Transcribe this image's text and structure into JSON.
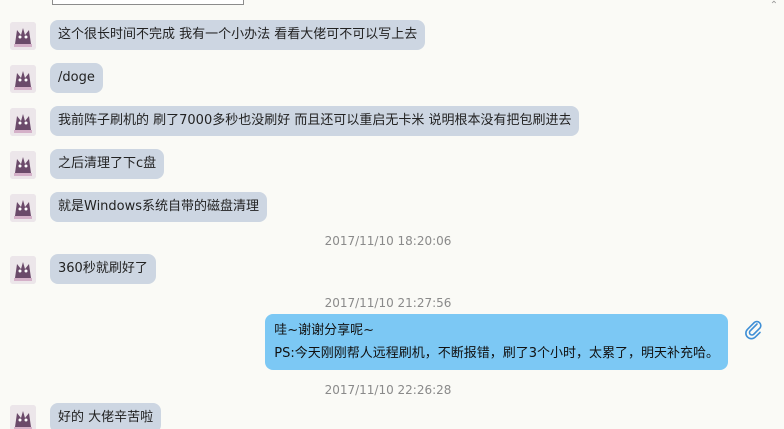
{
  "messages": [
    {
      "type": "in",
      "text": "这个很长时间不完成 我有一个小办法 看看大佬可不可以写上去"
    },
    {
      "type": "in",
      "text": "/doge"
    },
    {
      "type": "in",
      "text": "我前阵子刷机的 刷了7000多秒也没刷好 而且还可以重启无卡米 说明根本没有把包刷进去"
    },
    {
      "type": "in",
      "text": "之后清理了下c盘"
    },
    {
      "type": "in",
      "text": "就是Windows系统自带的磁盘清理"
    },
    {
      "type": "time",
      "text": "2017/11/10 18:20:06"
    },
    {
      "type": "in",
      "text": "360秒就刷好了"
    },
    {
      "type": "time",
      "text": "2017/11/10 21:27:56"
    },
    {
      "type": "out",
      "line1": "哇~谢谢分享呢~",
      "line2": "PS:今天刚刚帮人远程刷机，不断报错，刷了3个小时，太累了，明天补充哈。"
    },
    {
      "type": "time",
      "text": "2017/11/10 22:26:28"
    },
    {
      "type": "in",
      "text": "好的 大佬辛苦啦"
    }
  ],
  "colors": {
    "incoming_bubble": "#cdd6e2",
    "outgoing_bubble": "#7cc8f4",
    "background": "#fafaf6"
  },
  "icons": {
    "attachment": "paperclip-icon",
    "avatar": "avatar-icon",
    "scroll": "scroll-up-icon"
  }
}
